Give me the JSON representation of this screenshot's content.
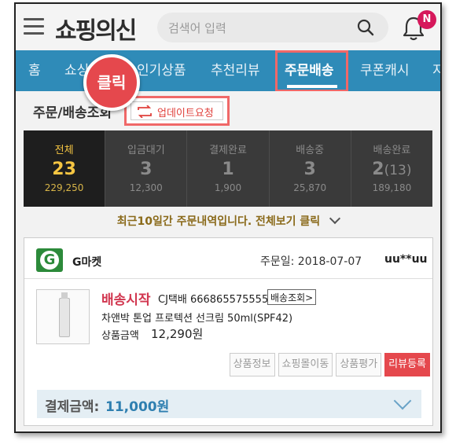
{
  "header": {
    "logo": "쇼핑의신",
    "search_placeholder": "검색어 입력",
    "notification_badge": "N"
  },
  "nav": {
    "items": [
      "홈",
      "쇼싱",
      "인기상품",
      "추천리뷰",
      "주문배송",
      "쿠폰캐시",
      "지"
    ],
    "active": "주문배송"
  },
  "subheader": {
    "title": "주문/배송조회",
    "update_button": "업데이트요청",
    "click_annotation": "클릭"
  },
  "stats": [
    {
      "name": "전체",
      "count": "23",
      "count_sub": "",
      "amount": "229,250"
    },
    {
      "name": "입금대기",
      "count": "3",
      "count_sub": "",
      "amount": "12,300"
    },
    {
      "name": "결제완료",
      "count": "1",
      "count_sub": "",
      "amount": "1,900"
    },
    {
      "name": "배송중",
      "count": "3",
      "count_sub": "",
      "amount": "25,870"
    },
    {
      "name": "배송완료",
      "count": "2",
      "count_sub": "(13)",
      "amount": "189,180"
    }
  ],
  "recent_notice": "최근10일간 주문내역입니다. 전체보기 클릭",
  "order": {
    "market": "G마켓",
    "order_date": "주문일: 2018-07-07",
    "buyer": "uu**uu",
    "status": "배송시작",
    "courier": "CJ택배 666865575555",
    "tracking_button": "배송조회>",
    "product_name": "차앤박 톤업 프로텍션 선크림 50ml(SPF42)",
    "price_label": "상품금액",
    "price": "12,290원",
    "actions": [
      "상품정보",
      "쇼핑몰이동",
      "상품평가",
      "리뷰등록"
    ],
    "payment_label": "결제금액:",
    "payment_value": "11,000원"
  }
}
